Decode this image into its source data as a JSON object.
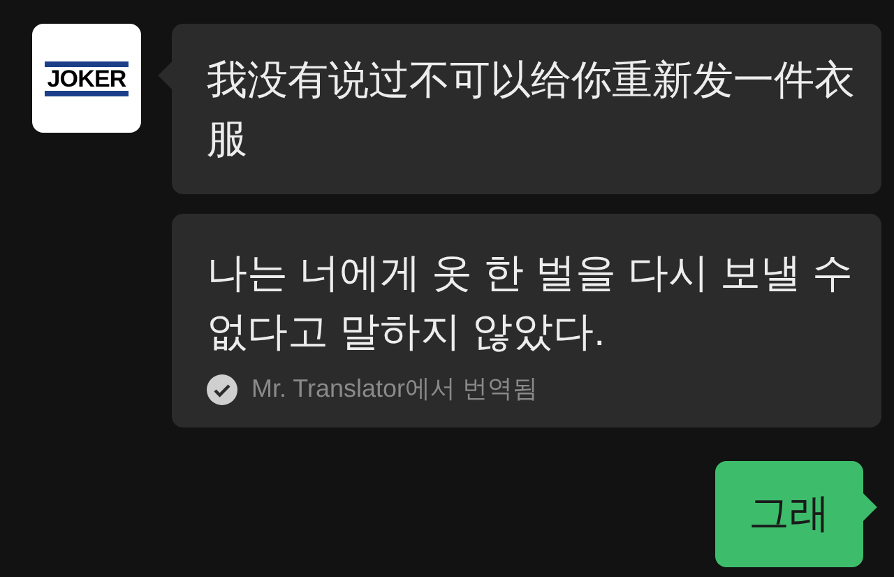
{
  "messages": [
    {
      "kind": "incoming",
      "avatar": {
        "text": "JOKER"
      },
      "text": "我没有说过不可以给你重新发一件衣服"
    },
    {
      "kind": "translation",
      "text": "나는 너에게 옷 한 벌을 다시 보낼 수 없다고 말하지 않았다.",
      "note": "Mr. Translator에서 번역됨"
    },
    {
      "kind": "outgoing",
      "text": "그래"
    }
  ]
}
